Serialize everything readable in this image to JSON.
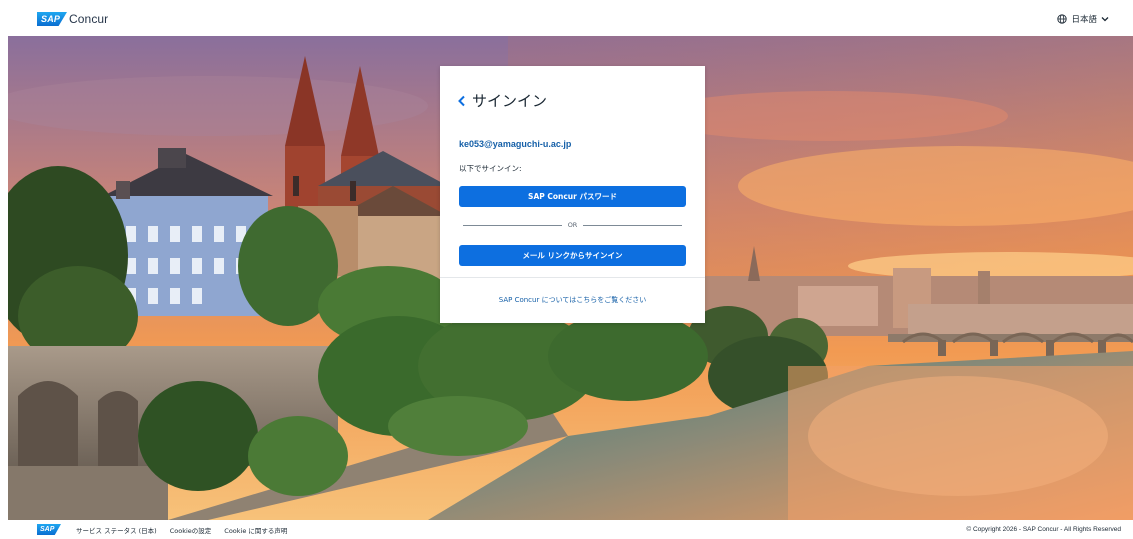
{
  "header": {
    "brand_logo_text": "SAP",
    "brand_name": "Concur",
    "language_label": "日本語",
    "icons": {
      "language": "globe-icon",
      "language_toggle": "chevron-down-icon"
    }
  },
  "signin": {
    "title": "サインイン",
    "back_icon": "chevron-left-icon",
    "email": "ke053@yamaguchi-u.ac.jp",
    "subtitle": "以下でサインイン:",
    "password_button": "SAP Concur パスワード",
    "or_text": "OR",
    "email_link_button": "メール リンクからサインイン",
    "about_link": "SAP Concur についてはこちらをご覧ください"
  },
  "footer": {
    "logo_text": "SAP",
    "links": [
      "サービス ステータス (日本)",
      "Cookieの設定",
      "Cookie に関する声明"
    ],
    "copyright": "© Copyright 2026 - SAP Concur - All Rights Reserved"
  },
  "colors": {
    "primary_button": "#0d6fe0",
    "link": "#1660a8",
    "sap_blue": "#0a6ed1"
  }
}
